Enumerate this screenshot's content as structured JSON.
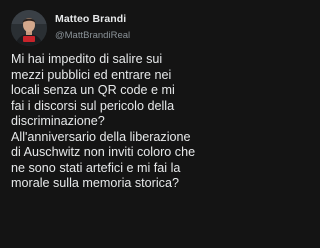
{
  "author": {
    "name": "Matteo Brandi",
    "handle": "@MattBrandiReal"
  },
  "tweet": {
    "lines": [
      "Mi hai impedito di salire sui",
      "mezzi pubblici ed entrare nei",
      "locali senza un QR code e mi",
      "fai i discorsi sul pericolo della",
      "discriminazione?",
      "All'anniversario della liberazione",
      "di Auschwitz non inviti coloro che",
      "ne sono stati artefici e mi fai la",
      "morale sulla memoria storica?"
    ]
  },
  "colors": {
    "background": "#141414",
    "text": "#e7e9ea",
    "secondary_text": "#8b9399"
  }
}
